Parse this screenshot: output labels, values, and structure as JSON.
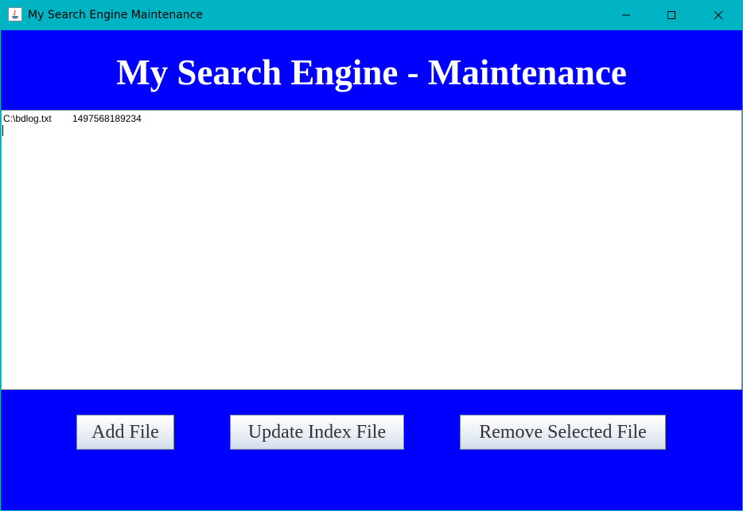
{
  "window": {
    "title": "My Search Engine Maintenance",
    "controls": {
      "minimize_icon": "minimize-icon",
      "maximize_icon": "maximize-icon",
      "close_icon": "close-icon"
    },
    "titlebar_color": "#00b4c4"
  },
  "header": {
    "title": "My Search Engine - Maintenance",
    "background_color": "#0000ff"
  },
  "file_list": {
    "rows": [
      {
        "path": "C:\\bdlog.txt",
        "timestamp": "1497568189234"
      }
    ]
  },
  "buttons": {
    "add_label": "Add File",
    "update_label": "Update Index File",
    "remove_label": "Remove Selected File"
  }
}
